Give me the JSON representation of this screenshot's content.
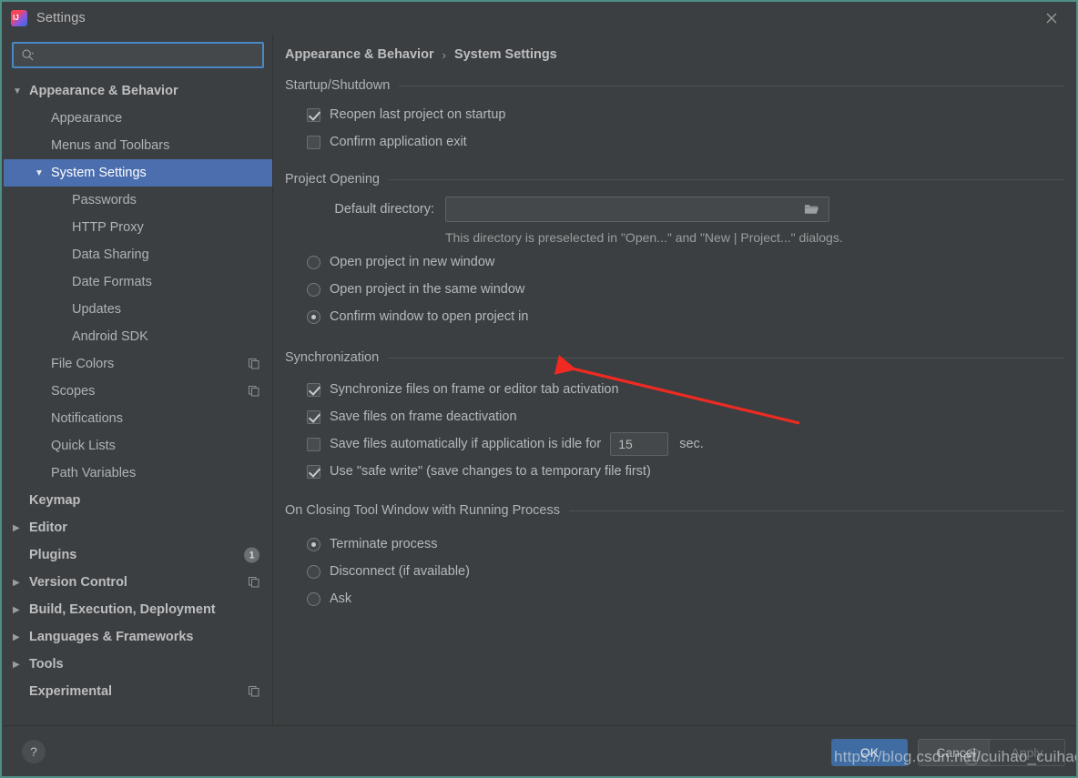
{
  "window": {
    "title": "Settings",
    "app_icon": "intellij-idea-icon",
    "close_icon": "close-icon"
  },
  "sidebar": {
    "search": {
      "value": "",
      "placeholder": "",
      "icon": "search-icon"
    },
    "items": [
      {
        "label": "Appearance & Behavior",
        "level": 0,
        "bold": true,
        "arrow": "down",
        "selected": false
      },
      {
        "label": "Appearance",
        "level": 1,
        "bold": false,
        "arrow": "none",
        "selected": false
      },
      {
        "label": "Menus and Toolbars",
        "level": 1,
        "bold": false,
        "arrow": "none",
        "selected": false
      },
      {
        "label": "System Settings",
        "level": 1,
        "bold": false,
        "arrow": "down",
        "selected": true
      },
      {
        "label": "Passwords",
        "level": 2,
        "bold": false,
        "arrow": "none",
        "selected": false
      },
      {
        "label": "HTTP Proxy",
        "level": 2,
        "bold": false,
        "arrow": "none",
        "selected": false
      },
      {
        "label": "Data Sharing",
        "level": 2,
        "bold": false,
        "arrow": "none",
        "selected": false
      },
      {
        "label": "Date Formats",
        "level": 2,
        "bold": false,
        "arrow": "none",
        "selected": false
      },
      {
        "label": "Updates",
        "level": 2,
        "bold": false,
        "arrow": "none",
        "selected": false
      },
      {
        "label": "Android SDK",
        "level": 2,
        "bold": false,
        "arrow": "none",
        "selected": false
      },
      {
        "label": "File Colors",
        "level": 1,
        "bold": false,
        "arrow": "none",
        "selected": false,
        "copy_icon": true
      },
      {
        "label": "Scopes",
        "level": 1,
        "bold": false,
        "arrow": "none",
        "selected": false,
        "copy_icon": true
      },
      {
        "label": "Notifications",
        "level": 1,
        "bold": false,
        "arrow": "none",
        "selected": false
      },
      {
        "label": "Quick Lists",
        "level": 1,
        "bold": false,
        "arrow": "none",
        "selected": false
      },
      {
        "label": "Path Variables",
        "level": 1,
        "bold": false,
        "arrow": "none",
        "selected": false
      },
      {
        "label": "Keymap",
        "level": 0,
        "bold": true,
        "arrow": "none",
        "selected": false
      },
      {
        "label": "Editor",
        "level": 0,
        "bold": true,
        "arrow": "right",
        "selected": false
      },
      {
        "label": "Plugins",
        "level": 0,
        "bold": true,
        "arrow": "none",
        "selected": false,
        "badge": "1"
      },
      {
        "label": "Version Control",
        "level": 0,
        "bold": true,
        "arrow": "right",
        "selected": false,
        "copy_icon": true
      },
      {
        "label": "Build, Execution, Deployment",
        "level": 0,
        "bold": true,
        "arrow": "right",
        "selected": false
      },
      {
        "label": "Languages & Frameworks",
        "level": 0,
        "bold": true,
        "arrow": "right",
        "selected": false
      },
      {
        "label": "Tools",
        "level": 0,
        "bold": true,
        "arrow": "right",
        "selected": false
      },
      {
        "label": "Experimental",
        "level": 0,
        "bold": true,
        "arrow": "none",
        "selected": false,
        "copy_icon": true
      }
    ]
  },
  "breadcrumb": {
    "parent": "Appearance & Behavior",
    "separator": "›",
    "current": "System Settings"
  },
  "sections": {
    "startup": {
      "title": "Startup/Shutdown",
      "options": [
        {
          "label": "Reopen last project on startup",
          "checked": true
        },
        {
          "label": "Confirm application exit",
          "checked": false
        }
      ]
    },
    "project_opening": {
      "title": "Project Opening",
      "directory_label": "Default directory:",
      "directory_value": "",
      "directory_icon": "folder-icon",
      "hint": "This directory is preselected in \"Open...\" and \"New | Project...\" dialogs.",
      "radios": [
        {
          "label": "Open project in new window",
          "checked": false
        },
        {
          "label": "Open project in the same window",
          "checked": false
        },
        {
          "label": "Confirm window to open project in",
          "checked": true
        }
      ]
    },
    "synchronization": {
      "title": "Synchronization",
      "options": [
        {
          "label": "Synchronize files on frame or editor tab activation",
          "checked": true
        },
        {
          "label": "Save files on frame deactivation",
          "checked": true
        },
        {
          "label": "Save files automatically if application is idle for",
          "checked": false,
          "spinner_value": "15",
          "suffix": "sec."
        },
        {
          "label": "Use \"safe write\" (save changes to a temporary file first)",
          "checked": true
        }
      ]
    },
    "closing_tool_window": {
      "title": "On Closing Tool Window with Running Process",
      "radios": [
        {
          "label": "Terminate process",
          "checked": true
        },
        {
          "label": "Disconnect (if available)",
          "checked": false
        },
        {
          "label": "Ask",
          "checked": false
        }
      ]
    }
  },
  "footer": {
    "help_label": "?",
    "ok_label": "OK",
    "cancel_label": "Cancel",
    "apply_label": "Apply"
  },
  "annotations": {
    "arrow_color": "#f02a22",
    "watermark": "https://blog.csdn.net/cuihao_cuihao",
    "watermark_badge": "@"
  },
  "colors": {
    "window_bg": "#3c3f41",
    "selection": "#4b6eaf",
    "accent": "#4a88c7",
    "text": "#b6b9bb"
  }
}
